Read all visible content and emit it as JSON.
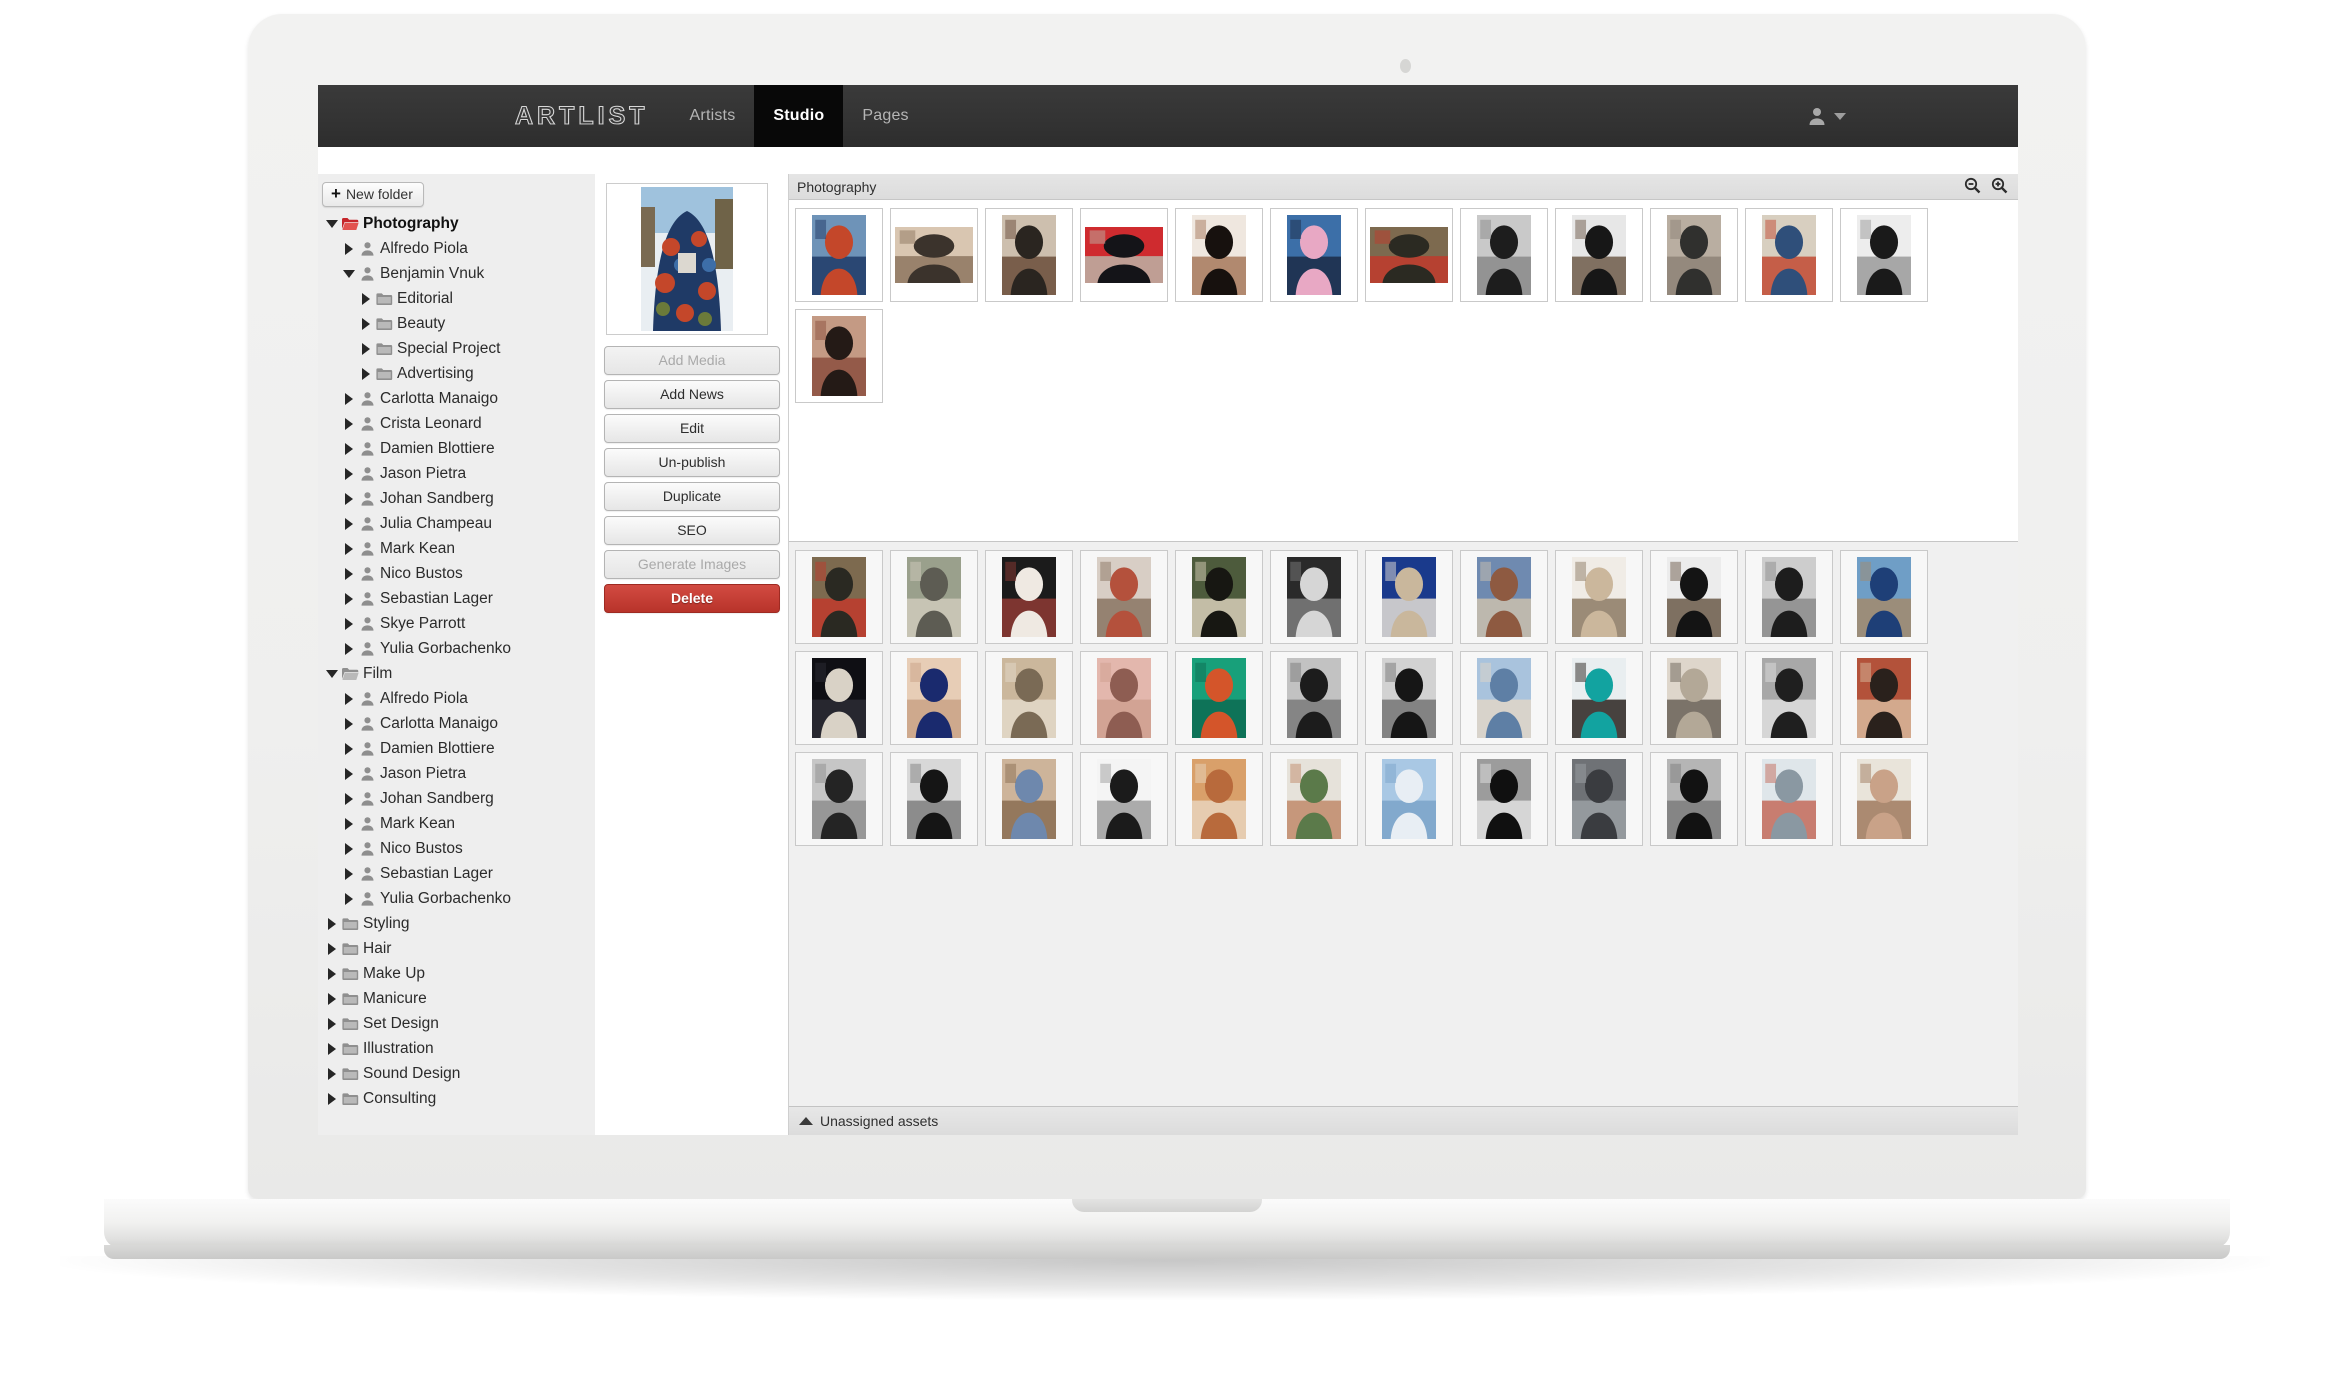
{
  "app": {
    "brand": "ARTLIST",
    "nav": [
      {
        "label": "Artists",
        "active": false
      },
      {
        "label": "Studio",
        "active": true
      },
      {
        "label": "Pages",
        "active": false
      }
    ],
    "user_menu": {
      "icon": "user-avatar-icon",
      "caret": "chevron-down-icon"
    }
  },
  "sidebar": {
    "new_folder_label": "New folder",
    "tree": [
      {
        "label": "Photography",
        "depth": 0,
        "icon": "folder-open-red-icon",
        "expanded": true,
        "selected": true
      },
      {
        "label": "Alfredo Piola",
        "depth": 1,
        "icon": "person-icon",
        "expanded": false,
        "selected": false
      },
      {
        "label": "Benjamin Vnuk",
        "depth": 1,
        "icon": "person-icon",
        "expanded": true,
        "selected": false
      },
      {
        "label": "Editorial",
        "depth": 2,
        "icon": "folder-grey-icon",
        "expanded": false,
        "selected": false
      },
      {
        "label": "Beauty",
        "depth": 2,
        "icon": "folder-grey-icon",
        "expanded": false,
        "selected": false
      },
      {
        "label": "Special Project",
        "depth": 2,
        "icon": "folder-grey-icon",
        "expanded": false,
        "selected": false
      },
      {
        "label": "Advertising",
        "depth": 2,
        "icon": "folder-grey-icon",
        "expanded": false,
        "selected": false
      },
      {
        "label": "Carlotta Manaigo",
        "depth": 1,
        "icon": "person-icon",
        "expanded": false,
        "selected": false
      },
      {
        "label": "Crista Leonard",
        "depth": 1,
        "icon": "person-icon",
        "expanded": false,
        "selected": false
      },
      {
        "label": "Damien Blottiere",
        "depth": 1,
        "icon": "person-icon",
        "expanded": false,
        "selected": false
      },
      {
        "label": "Jason Pietra",
        "depth": 1,
        "icon": "person-icon",
        "expanded": false,
        "selected": false
      },
      {
        "label": "Johan Sandberg",
        "depth": 1,
        "icon": "person-icon",
        "expanded": false,
        "selected": false
      },
      {
        "label": "Julia Champeau",
        "depth": 1,
        "icon": "person-icon",
        "expanded": false,
        "selected": false
      },
      {
        "label": "Mark Kean",
        "depth": 1,
        "icon": "person-icon",
        "expanded": false,
        "selected": false
      },
      {
        "label": "Nico Bustos",
        "depth": 1,
        "icon": "person-icon",
        "expanded": false,
        "selected": false
      },
      {
        "label": "Sebastian Lager",
        "depth": 1,
        "icon": "person-icon",
        "expanded": false,
        "selected": false
      },
      {
        "label": "Skye Parrott",
        "depth": 1,
        "icon": "person-icon",
        "expanded": false,
        "selected": false
      },
      {
        "label": "Yulia Gorbachenko",
        "depth": 1,
        "icon": "person-icon",
        "expanded": false,
        "selected": false
      },
      {
        "label": "Film",
        "depth": 0,
        "icon": "folder-open-grey-icon",
        "expanded": true,
        "selected": false
      },
      {
        "label": "Alfredo Piola",
        "depth": 1,
        "icon": "person-icon",
        "expanded": false,
        "selected": false
      },
      {
        "label": "Carlotta Manaigo",
        "depth": 1,
        "icon": "person-icon",
        "expanded": false,
        "selected": false
      },
      {
        "label": "Damien Blottiere",
        "depth": 1,
        "icon": "person-icon",
        "expanded": false,
        "selected": false
      },
      {
        "label": "Jason Pietra",
        "depth": 1,
        "icon": "person-icon",
        "expanded": false,
        "selected": false
      },
      {
        "label": "Johan Sandberg",
        "depth": 1,
        "icon": "person-icon",
        "expanded": false,
        "selected": false
      },
      {
        "label": "Mark Kean",
        "depth": 1,
        "icon": "person-icon",
        "expanded": false,
        "selected": false
      },
      {
        "label": "Nico Bustos",
        "depth": 1,
        "icon": "person-icon",
        "expanded": false,
        "selected": false
      },
      {
        "label": "Sebastian Lager",
        "depth": 1,
        "icon": "person-icon",
        "expanded": false,
        "selected": false
      },
      {
        "label": "Yulia Gorbachenko",
        "depth": 1,
        "icon": "person-icon",
        "expanded": false,
        "selected": false
      },
      {
        "label": "Styling",
        "depth": 0,
        "icon": "folder-grey-icon",
        "expanded": false,
        "selected": false
      },
      {
        "label": "Hair",
        "depth": 0,
        "icon": "folder-grey-icon",
        "expanded": false,
        "selected": false
      },
      {
        "label": "Make Up",
        "depth": 0,
        "icon": "folder-grey-icon",
        "expanded": false,
        "selected": false
      },
      {
        "label": "Manicure",
        "depth": 0,
        "icon": "folder-grey-icon",
        "expanded": false,
        "selected": false
      },
      {
        "label": "Set Design",
        "depth": 0,
        "icon": "folder-grey-icon",
        "expanded": false,
        "selected": false
      },
      {
        "label": "Illustration",
        "depth": 0,
        "icon": "folder-grey-icon",
        "expanded": false,
        "selected": false
      },
      {
        "label": "Sound Design",
        "depth": 0,
        "icon": "folder-grey-icon",
        "expanded": false,
        "selected": false
      },
      {
        "label": "Consulting",
        "depth": 0,
        "icon": "folder-grey-icon",
        "expanded": false,
        "selected": false
      }
    ]
  },
  "detail": {
    "preview_alt": "camouflage-jacket-snow-forest-thumbnail",
    "buttons": [
      {
        "label": "Add Media",
        "state": "disabled",
        "style": "default"
      },
      {
        "label": "Add News",
        "state": "enabled",
        "style": "default"
      },
      {
        "label": "Edit",
        "state": "enabled",
        "style": "default"
      },
      {
        "label": "Un-publish",
        "state": "enabled",
        "style": "default"
      },
      {
        "label": "Duplicate",
        "state": "enabled",
        "style": "default"
      },
      {
        "label": "SEO",
        "state": "enabled",
        "style": "default"
      },
      {
        "label": "Generate Images",
        "state": "disabled",
        "style": "default"
      },
      {
        "label": "Delete",
        "state": "enabled",
        "style": "danger"
      }
    ]
  },
  "content": {
    "title": "Photography",
    "zoom_out_icon": "zoom-out-icon",
    "zoom_in_icon": "zoom-in-icon",
    "assigned_thumbnails": [
      {
        "alt": "camouflage-jacket-snow",
        "c1": "#6e93b8",
        "c2": "#c4472a",
        "c3": "#1f3a66",
        "orient": "portrait"
      },
      {
        "alt": "portrait-woman-hand-in-hair",
        "c1": "#d9c6b1",
        "c2": "#3b332c",
        "c3": "#8d7660",
        "orient": "landscape"
      },
      {
        "alt": "two-models-black-dresses",
        "c1": "#cdbfae",
        "c2": "#2a2520",
        "c3": "#6a4c3a",
        "orient": "portrait"
      },
      {
        "alt": "shoe-on-red-table",
        "c1": "#cf2b2f",
        "c2": "#141418",
        "c3": "#bcb3a6",
        "orient": "landscape"
      },
      {
        "alt": "face-with-black-graphic-paint",
        "c1": "#efe7df",
        "c2": "#17110e",
        "c3": "#a6785c",
        "orient": "portrait"
      },
      {
        "alt": "blue-collage-pink-clutch",
        "c1": "#3c6fa8",
        "c2": "#e8a8c4",
        "c3": "#1b2c46",
        "orient": "portrait"
      },
      {
        "alt": "model-in-car-sunglasses",
        "c1": "#7d6a4f",
        "c2": "#2b2a22",
        "c3": "#c0392b",
        "orient": "landscape"
      },
      {
        "alt": "bw-portrait-scarf",
        "c1": "#c9c9c9",
        "c2": "#1d1d1d",
        "c3": "#8a8a8a",
        "orient": "portrait"
      },
      {
        "alt": "woman-black-leather-dress",
        "c1": "#e7e7e7",
        "c2": "#171717",
        "c3": "#6d5a49",
        "orient": "portrait"
      },
      {
        "alt": "two-people-studio-grey",
        "c1": "#b9aea1",
        "c2": "#30302e",
        "c3": "#8d8277",
        "orient": "portrait"
      },
      {
        "alt": "abstract-circle-collage",
        "c1": "#d8cfc0",
        "c2": "#2f4f7a",
        "c3": "#c24a32",
        "orient": "portrait"
      },
      {
        "alt": "bw-figure-white-shirt",
        "c1": "#ededed",
        "c2": "#1a1a1a",
        "c3": "#9a9a9a",
        "orient": "portrait"
      },
      {
        "alt": "portrait-woman-dark-hair",
        "c1": "#c49a84",
        "c2": "#241a16",
        "c3": "#8c4f3e",
        "orient": "portrait"
      }
    ],
    "unassigned_thumbnails": [
      {
        "alt": "model-in-car-sunglasses",
        "c1": "#7d6a4f",
        "c2": "#2a2922",
        "c3": "#c0392b",
        "orient": "portrait"
      },
      {
        "alt": "stone-face-sculpture",
        "c1": "#9aa08c",
        "c2": "#5d5c53",
        "c3": "#cfcabb",
        "orient": "portrait"
      },
      {
        "alt": "givenchy-campaign",
        "c1": "#1b1b1b",
        "c2": "#efe9e2",
        "c3": "#8e3a34",
        "orient": "portrait"
      },
      {
        "alt": "blonde-model-red-top",
        "c1": "#d8cec5",
        "c2": "#b4513c",
        "c3": "#8a7462",
        "orient": "portrait"
      },
      {
        "alt": "dapper-dan-editorial",
        "c1": "#4d5b3c",
        "c2": "#171712",
        "c3": "#d8cfb8",
        "orient": "portrait"
      },
      {
        "alt": "bw-band-performance",
        "c1": "#2a2a2a",
        "c2": "#d6d6d6",
        "c3": "#7c7c7c",
        "orient": "portrait"
      },
      {
        "alt": "blue-curtain-pedestals",
        "c1": "#1a3a8c",
        "c2": "#c9b79c",
        "c3": "#e6e0d6",
        "orient": "portrait"
      },
      {
        "alt": "couple-in-denim",
        "c1": "#6f8ab0",
        "c2": "#8e5a41",
        "c3": "#cbbfae",
        "orient": "portrait"
      },
      {
        "alt": "hat-on-white-plate",
        "c1": "#f0ece6",
        "c2": "#cbb79c",
        "c3": "#8c7a63",
        "orient": "portrait"
      },
      {
        "alt": "woman-black-leather-dress",
        "c1": "#ececec",
        "c2": "#141414",
        "c3": "#6b5a49",
        "orient": "portrait"
      },
      {
        "alt": "bw-portrait-scarf",
        "c1": "#cdcdcd",
        "c2": "#1d1d1d",
        "c3": "#8b8b8b",
        "orient": "portrait"
      },
      {
        "alt": "skater-blue-jacket-street",
        "c1": "#6f9ec6",
        "c2": "#1e3f77",
        "c3": "#a38a6c",
        "orient": "portrait"
      },
      {
        "alt": "dark-striped-sleeve",
        "c1": "#0f0f14",
        "c2": "#d9d2c6",
        "c3": "#2b2b34",
        "orient": "portrait"
      },
      {
        "alt": "legs-with-heels",
        "c1": "#e7cdb6",
        "c2": "#1a2a6e",
        "c3": "#c9a286",
        "orient": "portrait"
      },
      {
        "alt": "staircase-architecture",
        "c1": "#cbb79c",
        "c2": "#7a6a55",
        "c3": "#e3d9c9",
        "orient": "portrait"
      },
      {
        "alt": "model-pink-dress",
        "c1": "#e3b7ad",
        "c2": "#8e5d52",
        "c3": "#cfa08f",
        "orient": "portrait"
      },
      {
        "alt": "green-tiles-orange-frame",
        "c1": "#18a07a",
        "c2": "#d4552a",
        "c3": "#0d6b52",
        "orient": "portrait"
      },
      {
        "alt": "bw-man-with-hat",
        "c1": "#c2c2c2",
        "c2": "#1c1c1c",
        "c3": "#7a7a7a",
        "orient": "portrait"
      },
      {
        "alt": "bw-portrait-jacket",
        "c1": "#d2d2d2",
        "c2": "#161616",
        "c3": "#767676",
        "orient": "portrait"
      },
      {
        "alt": "model-denim-shirt",
        "c1": "#a9c3dd",
        "c2": "#5e7fa5",
        "c3": "#e0d6c8",
        "orient": "portrait"
      },
      {
        "alt": "man-teal-trousers",
        "c1": "#e9eef0",
        "c2": "#12a3a0",
        "c3": "#2a2320",
        "orient": "portrait"
      },
      {
        "alt": "still-life-beige-forms",
        "c1": "#ded6cb",
        "c2": "#b3a897",
        "c3": "#6a6158",
        "orient": "portrait"
      },
      {
        "alt": "bw-group-of-people",
        "c1": "#a8a8a8",
        "c2": "#1f1f1f",
        "c3": "#dedede",
        "orient": "portrait"
      },
      {
        "alt": "models-red-brown-tones",
        "c1": "#b3523a",
        "c2": "#2a211c",
        "c3": "#d8b89c",
        "orient": "portrait"
      },
      {
        "alt": "bw-long-hair-portrait",
        "c1": "#c6c6c6",
        "c2": "#242424",
        "c3": "#8e8e8e",
        "orient": "portrait"
      },
      {
        "alt": "bw-reclining-figure",
        "c1": "#d8d8d8",
        "c2": "#151515",
        "c3": "#7f7f7f",
        "orient": "portrait"
      },
      {
        "alt": "blue-jeans-on-bench",
        "c1": "#cdb49a",
        "c2": "#6e88ad",
        "c3": "#8a6d52",
        "orient": "portrait"
      },
      {
        "alt": "framed-bw-artwork",
        "c1": "#f4f4f4",
        "c2": "#1b1b1b",
        "c3": "#9e9e9e",
        "orient": "portrait"
      },
      {
        "alt": "orange-curtain-figure",
        "c1": "#d9a06a",
        "c2": "#b86a3c",
        "c3": "#e8d4bc",
        "orient": "portrait"
      },
      {
        "alt": "three-models-swimwear",
        "c1": "#e6e2da",
        "c2": "#5b7a4a",
        "c3": "#c08a6a",
        "orient": "portrait"
      },
      {
        "alt": "sky-with-clouds",
        "c1": "#a9c8e4",
        "c2": "#e8eef4",
        "c3": "#7ba3c9",
        "orient": "portrait"
      },
      {
        "alt": "bw-model-black-suit",
        "c1": "#9c9c9c",
        "c2": "#101010",
        "c3": "#e0e0e0",
        "orient": "portrait"
      },
      {
        "alt": "grey-draped-fabric",
        "c1": "#6f7276",
        "c2": "#3a3c40",
        "c3": "#9ba0a4",
        "orient": "portrait"
      },
      {
        "alt": "bw-bending-figure",
        "c1": "#b5b5b5",
        "c2": "#121212",
        "c3": "#7d7d7d",
        "orient": "portrait"
      },
      {
        "alt": "window-light-interior",
        "c1": "#dfe6ea",
        "c2": "#8a98a2",
        "c3": "#c46a5a",
        "orient": "portrait"
      },
      {
        "alt": "nude-tone-figure",
        "c1": "#e9e4da",
        "c2": "#c9a288",
        "c3": "#a07a5e",
        "orient": "portrait"
      }
    ],
    "status_label": "Unassigned assets",
    "status_icon": "chevron-up-icon"
  },
  "colors": {
    "nav_bg": "#343434",
    "nav_active_bg": "#080808",
    "sidebar_bg": "#eeeeee",
    "folder_selected": "#d6262a",
    "danger": "#c0392b",
    "panel_bg": "#f0f0f0"
  }
}
